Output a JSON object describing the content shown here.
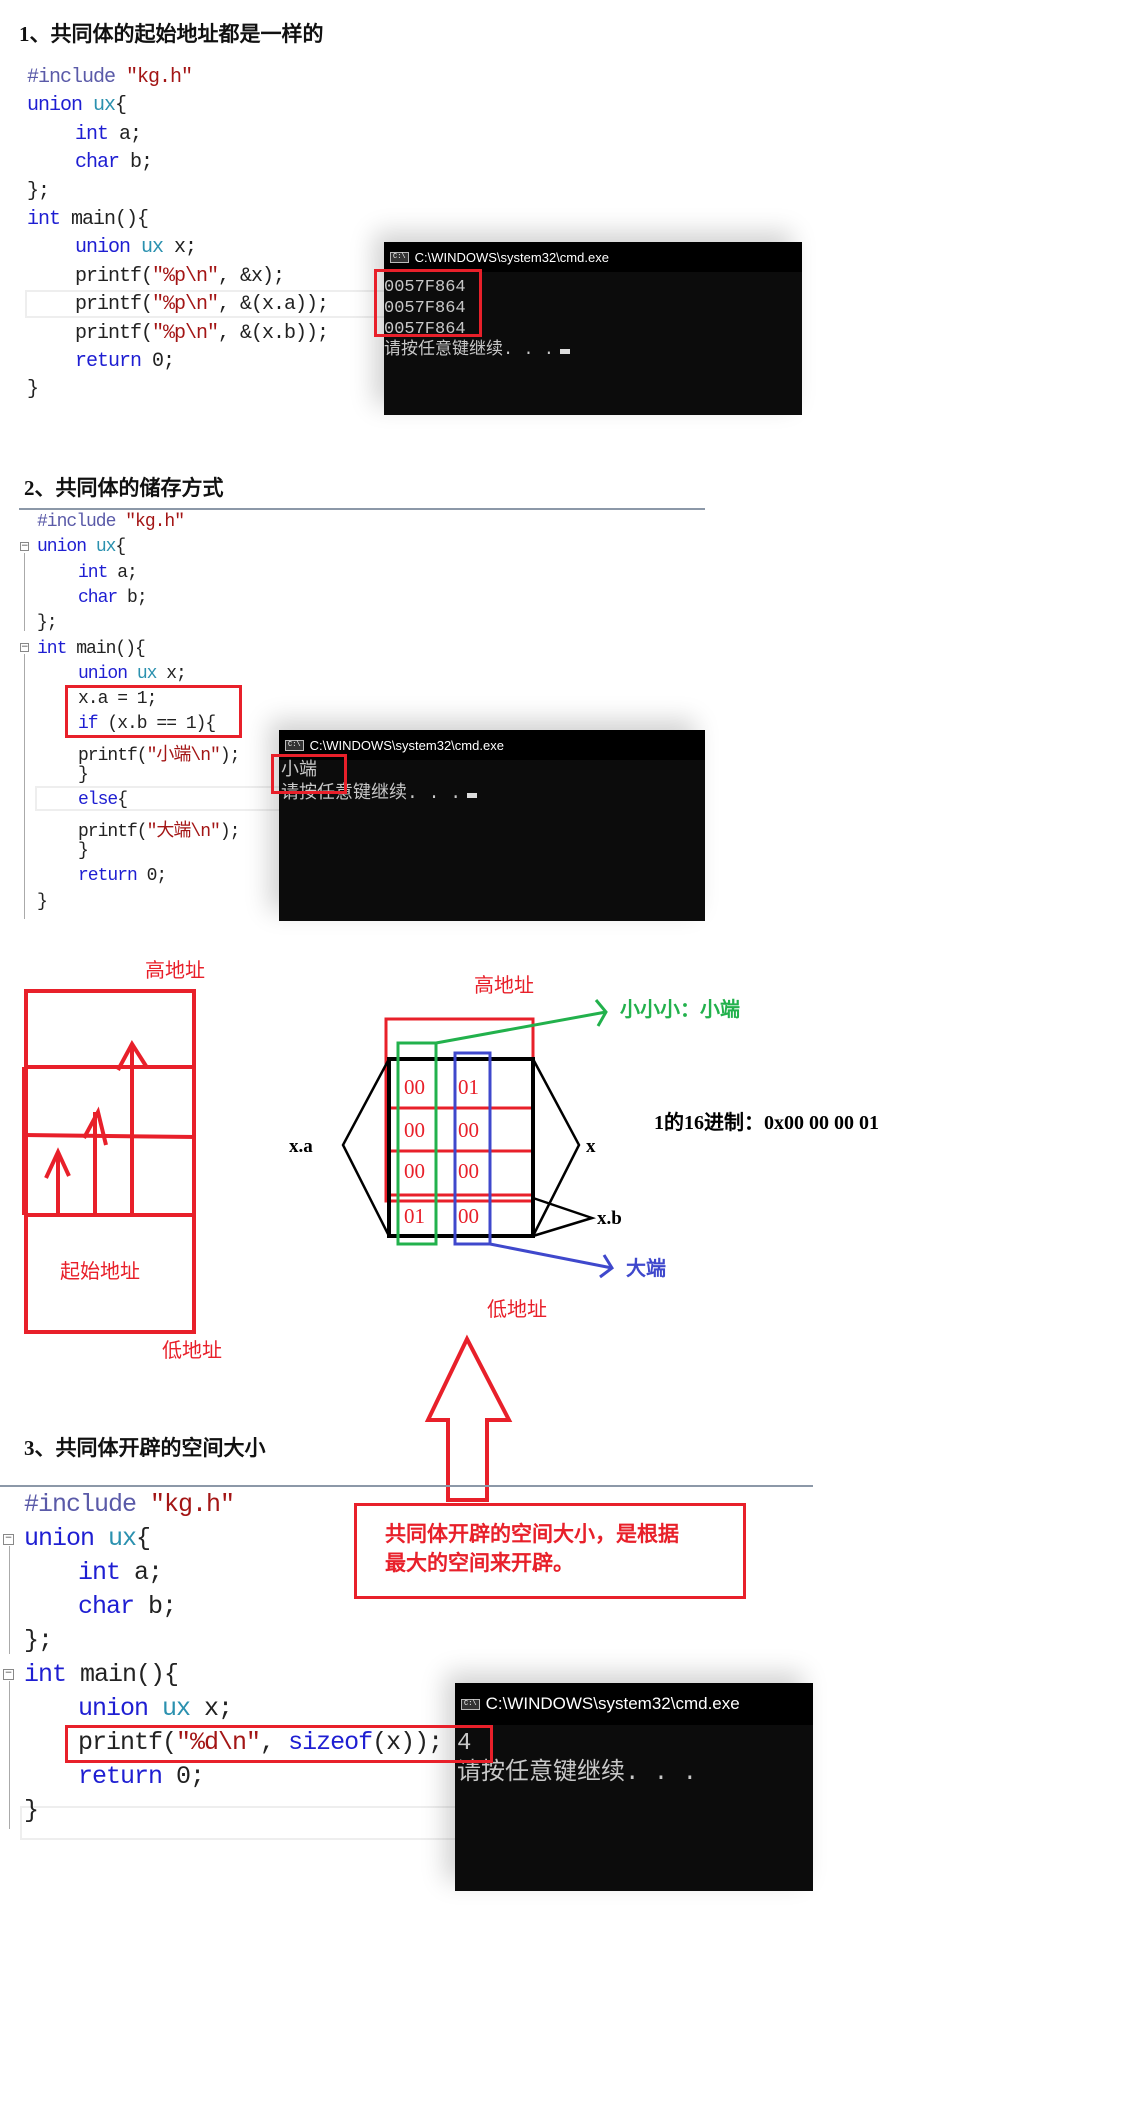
{
  "sections": [
    {
      "title": "1、共同体的起始地址都是一样的",
      "code": [
        {
          "indent": 0,
          "tokens": [
            [
              "#include ",
              "pp"
            ],
            [
              "\"kg.h\"",
              "st"
            ]
          ]
        },
        {
          "indent": 0,
          "tokens": [
            [
              "union ",
              "kw"
            ],
            [
              "ux",
              "ty"
            ],
            [
              "{",
              "pl"
            ]
          ]
        },
        {
          "indent": 1,
          "tokens": [
            [
              "int ",
              "kw"
            ],
            [
              "a;",
              "pl"
            ]
          ]
        },
        {
          "indent": 1,
          "tokens": [
            [
              "char ",
              "kw"
            ],
            [
              "b;",
              "pl"
            ]
          ]
        },
        {
          "indent": 0,
          "tokens": [
            [
              "};",
              "pl"
            ]
          ]
        },
        {
          "indent": 0,
          "tokens": [
            [
              "int ",
              "kw"
            ],
            [
              "main(){",
              "pl"
            ]
          ]
        },
        {
          "indent": 1,
          "tokens": [
            [
              "union ",
              "kw"
            ],
            [
              "ux ",
              "ty"
            ],
            [
              "x;",
              "pl"
            ]
          ]
        },
        {
          "indent": 1,
          "tokens": [
            [
              "printf(",
              "pl"
            ],
            [
              "\"%p\\n\"",
              "st"
            ],
            [
              ", &x);",
              "pl"
            ]
          ]
        },
        {
          "indent": 1,
          "tokens": [
            [
              "printf(",
              "pl"
            ],
            [
              "\"%p\\n\"",
              "st"
            ],
            [
              ", &(x.a));",
              "pl"
            ]
          ]
        },
        {
          "indent": 1,
          "tokens": [
            [
              "printf(",
              "pl"
            ],
            [
              "\"%p\\n\"",
              "st"
            ],
            [
              ", &(x.b));",
              "pl"
            ]
          ]
        },
        {
          "indent": 1,
          "tokens": [
            [
              "return ",
              "kw"
            ],
            [
              "0;",
              "pl"
            ]
          ]
        },
        {
          "indent": 0,
          "tokens": [
            [
              "}",
              "pl"
            ]
          ]
        }
      ],
      "console": {
        "title": "C:\\WINDOWS\\system32\\cmd.exe",
        "icon": "console-app-icon",
        "lines": [
          "0057F864",
          "0057F864",
          "0057F864",
          "请按任意键继续. . ."
        ]
      }
    },
    {
      "title": "2、共同体的储存方式",
      "code": [
        {
          "indent": 0,
          "tokens": [
            [
              "#include ",
              "pp"
            ],
            [
              "\"kg.h\"",
              "st"
            ]
          ]
        },
        {
          "indent": 0,
          "tokens": [
            [
              "union ",
              "kw"
            ],
            [
              "ux",
              "ty"
            ],
            [
              "{",
              "pl"
            ]
          ]
        },
        {
          "indent": 1,
          "tokens": [
            [
              "int ",
              "kw"
            ],
            [
              "a;",
              "pl"
            ]
          ]
        },
        {
          "indent": 1,
          "tokens": [
            [
              "char ",
              "kw"
            ],
            [
              "b;",
              "pl"
            ]
          ]
        },
        {
          "indent": 0,
          "tokens": [
            [
              "};",
              "pl"
            ]
          ]
        },
        {
          "indent": 0,
          "tokens": [
            [
              "int ",
              "kw"
            ],
            [
              "main(){",
              "pl"
            ]
          ]
        },
        {
          "indent": 1,
          "tokens": [
            [
              "union ",
              "kw"
            ],
            [
              "ux ",
              "ty"
            ],
            [
              "x;",
              "pl"
            ]
          ]
        },
        {
          "indent": 1,
          "tokens": [
            [
              "x.a = 1;",
              "pl"
            ]
          ]
        },
        {
          "indent": 1,
          "tokens": [
            [
              "if ",
              "kw"
            ],
            [
              "(x.b == 1){",
              "pl"
            ]
          ]
        },
        {
          "indent": 1,
          "tokens": [
            [
              "printf(",
              "pl"
            ],
            [
              "\"小端\\n\"",
              "st"
            ],
            [
              ");",
              "pl"
            ]
          ]
        },
        {
          "indent": 1,
          "tokens": [
            [
              "}",
              "pl"
            ]
          ]
        },
        {
          "indent": 1,
          "tokens": [
            [
              "else",
              "kw"
            ],
            [
              "{",
              "pl"
            ]
          ]
        },
        {
          "indent": 1,
          "tokens": [
            [
              "printf(",
              "pl"
            ],
            [
              "\"大端\\n\"",
              "st"
            ],
            [
              ");",
              "pl"
            ]
          ]
        },
        {
          "indent": 1,
          "tokens": [
            [
              "}",
              "pl"
            ]
          ]
        },
        {
          "indent": 1,
          "tokens": [
            [
              "return ",
              "kw"
            ],
            [
              "0;",
              "pl"
            ]
          ]
        },
        {
          "indent": 0,
          "tokens": [
            [
              "}",
              "pl"
            ]
          ]
        }
      ],
      "console": {
        "title": "C:\\WINDOWS\\system32\\cmd.exe",
        "icon": "console-app-icon",
        "lines": [
          "小端",
          "请按任意键继续. . ."
        ]
      }
    },
    {
      "title": "3、共同体开辟的空间大小",
      "code": [
        {
          "indent": 0,
          "tokens": [
            [
              "#include ",
              "pp"
            ],
            [
              "\"kg.h\"",
              "st"
            ]
          ]
        },
        {
          "indent": 0,
          "tokens": [
            [
              "union ",
              "kw"
            ],
            [
              "ux",
              "ty"
            ],
            [
              "{",
              "pl"
            ]
          ]
        },
        {
          "indent": 1,
          "tokens": [
            [
              "int ",
              "kw"
            ],
            [
              "a;",
              "pl"
            ]
          ]
        },
        {
          "indent": 1,
          "tokens": [
            [
              "char ",
              "kw"
            ],
            [
              "b;",
              "pl"
            ]
          ]
        },
        {
          "indent": 0,
          "tokens": [
            [
              "};",
              "pl"
            ]
          ]
        },
        {
          "indent": 0,
          "tokens": [
            [
              "int ",
              "kw"
            ],
            [
              "main(){",
              "pl"
            ]
          ]
        },
        {
          "indent": 1,
          "tokens": [
            [
              "union ",
              "kw"
            ],
            [
              "ux ",
              "ty"
            ],
            [
              "x;",
              "pl"
            ]
          ]
        },
        {
          "indent": 1,
          "tokens": [
            [
              "printf(",
              "pl"
            ],
            [
              "\"%d\\n\"",
              "st"
            ],
            [
              ", ",
              "pl"
            ],
            [
              "sizeof",
              "kw"
            ],
            [
              "(x));",
              "pl"
            ]
          ]
        },
        {
          "indent": 1,
          "tokens": [
            [
              "return ",
              "kw"
            ],
            [
              "0;",
              "pl"
            ]
          ]
        },
        {
          "indent": 0,
          "tokens": [
            [
              "}",
              "pl"
            ]
          ]
        }
      ],
      "console": {
        "title": "C:\\WINDOWS\\system32\\cmd.exe",
        "icon": "console-app-icon",
        "lines": [
          "4",
          "请按任意键继续. . ."
        ]
      }
    }
  ],
  "diagram": {
    "left": {
      "high": "高地址",
      "start": "起始地址",
      "low": "低地址"
    },
    "right": {
      "high": "高地址",
      "low": "低地址",
      "cells": [
        [
          "00",
          "01"
        ],
        [
          "00",
          "00"
        ],
        [
          "00",
          "00"
        ],
        [
          "01",
          "00"
        ]
      ],
      "label_xa": "x.a",
      "label_x": "x",
      "label_xb": "x.b",
      "little_endian": "小小小：小端",
      "big_endian": "大端",
      "hex_note": "1的16进制：0x00 00 00 01"
    },
    "note": [
      "共同体开辟的空间大小，是根据",
      "最大的空间来开辟。"
    ],
    "colors": {
      "red": "#e8202a",
      "green": "#22b14c",
      "blue": "#3f48cc",
      "black": "#000000"
    }
  }
}
